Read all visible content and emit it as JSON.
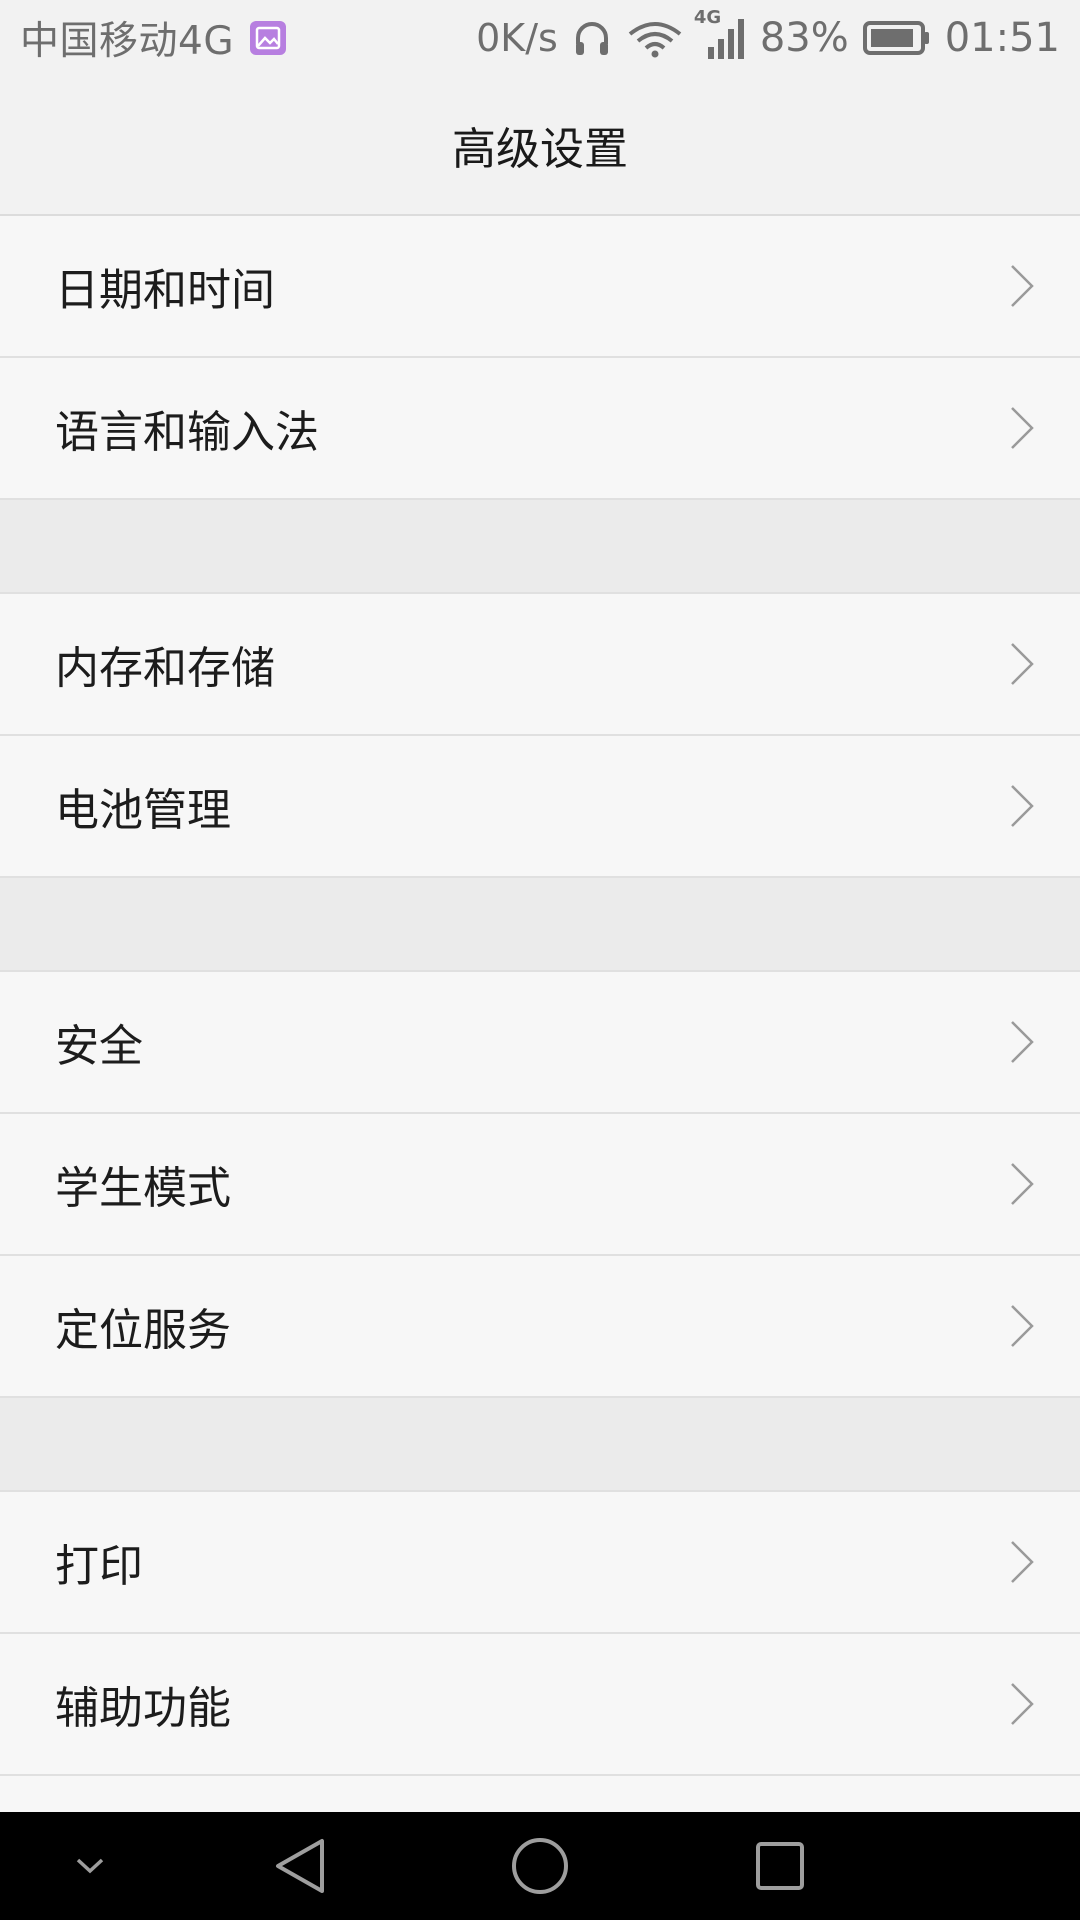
{
  "status_bar": {
    "carrier": "中国移动4G",
    "net_speed": "0K/s",
    "network_type": "4G",
    "battery_percent": "83%",
    "time": "01:51",
    "icons": [
      "photo-notification-icon",
      "headphones-icon",
      "wifi-icon",
      "signal-icon",
      "battery-icon"
    ]
  },
  "header": {
    "title": "高级设置"
  },
  "sections": [
    {
      "items": [
        {
          "label": "日期和时间"
        },
        {
          "label": "语言和输入法"
        }
      ]
    },
    {
      "items": [
        {
          "label": "内存和存储"
        },
        {
          "label": "电池管理"
        }
      ]
    },
    {
      "items": [
        {
          "label": "安全"
        },
        {
          "label": "学生模式"
        },
        {
          "label": "定位服务"
        }
      ]
    },
    {
      "items": [
        {
          "label": "打印"
        },
        {
          "label": "辅助功能"
        }
      ]
    }
  ],
  "nav_bar": {
    "icons": [
      "chevron-down-icon",
      "back-icon",
      "home-icon",
      "recents-icon"
    ]
  },
  "colors": {
    "background": "#f7f7f7",
    "header": "#f2f2f2",
    "separator": "#ebebeb",
    "nav": "#000000",
    "accent_notification": "#b77fe0"
  }
}
